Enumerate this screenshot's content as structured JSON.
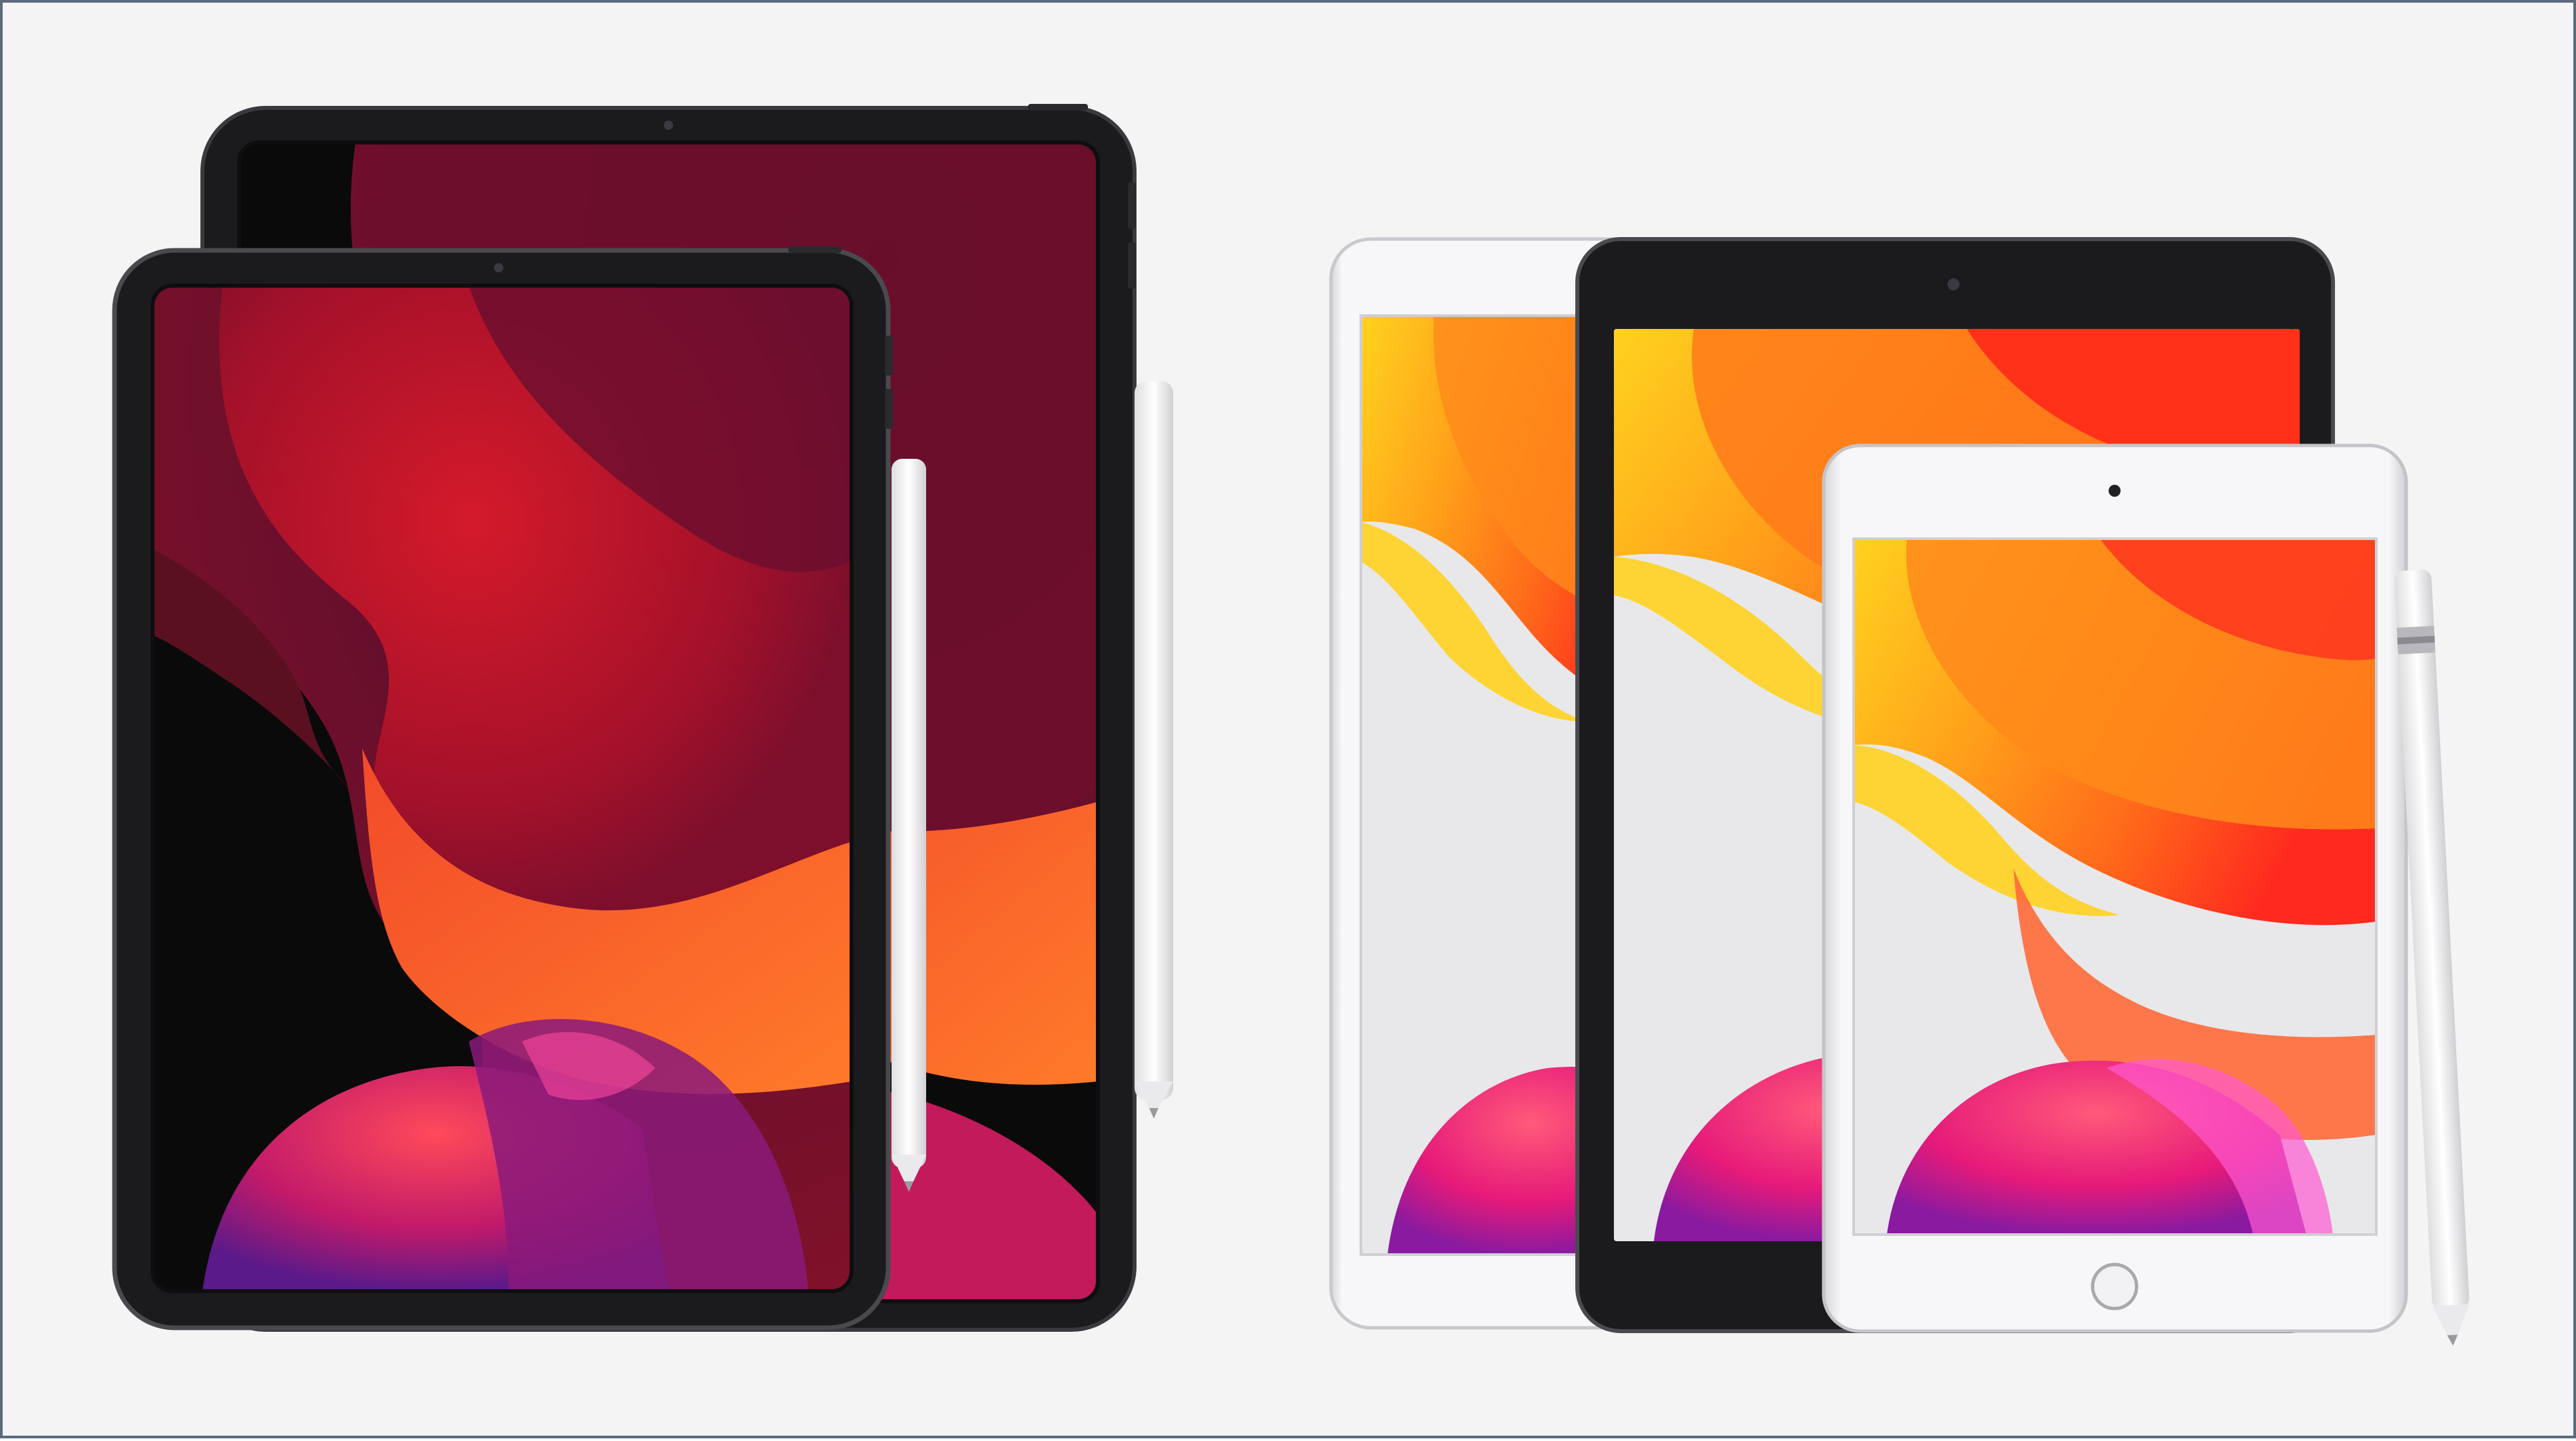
{
  "image": {
    "subject": "ipad-lineup",
    "background_color": "#f4f4f5",
    "border_color": "#5b6b7c"
  },
  "devices": [
    {
      "id": "ipad-pro-large",
      "finish": "space-gray",
      "wallpaper": "dark-red"
    },
    {
      "id": "ipad-pro-small",
      "finish": "space-gray",
      "wallpaper": "dark-red"
    },
    {
      "id": "ipad-air",
      "finish": "silver",
      "wallpaper": "light-orange"
    },
    {
      "id": "ipad-10-2",
      "finish": "space-gray",
      "wallpaper": "light-orange"
    },
    {
      "id": "ipad-mini",
      "finish": "silver",
      "wallpaper": "light-orange"
    }
  ],
  "accessories": [
    {
      "id": "apple-pencil-2nd-gen-a"
    },
    {
      "id": "apple-pencil-2nd-gen-b"
    },
    {
      "id": "apple-pencil-1st-gen"
    }
  ],
  "colors": {
    "dark_wallpaper": [
      "#4a0f2a",
      "#7e0f2c",
      "#b8112a",
      "#e23a28",
      "#ff6a2a",
      "#d21d6a",
      "#7a1f8f"
    ],
    "light_wallpaper": [
      "#ffd21f",
      "#ffa31a",
      "#ff6a1a",
      "#ff3e1f",
      "#e6e6e8",
      "#ff3a6e",
      "#b21fb0"
    ],
    "space_gray_bezel": "#1a1a1c",
    "silver_frame": "#f5f5f7"
  }
}
